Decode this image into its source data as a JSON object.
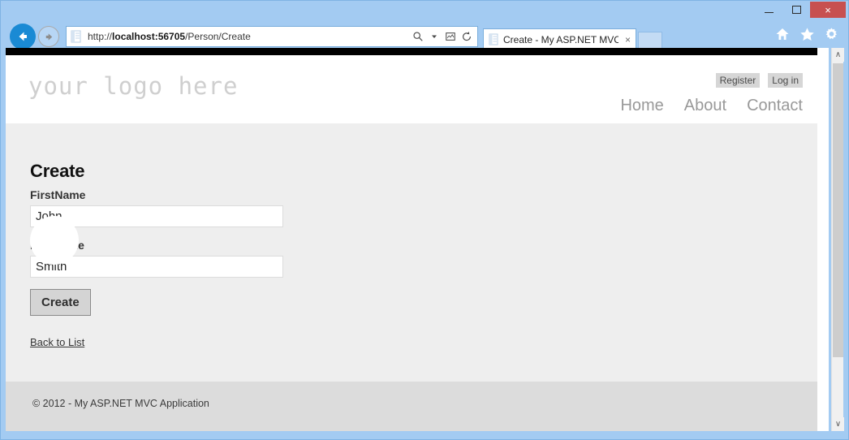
{
  "browser": {
    "window_controls": {
      "minimize": "–",
      "maximize": "□",
      "close": "×"
    },
    "back_icon": "back-arrow-icon",
    "forward_icon": "forward-arrow-icon",
    "url_prefix": "http://",
    "url_host": "localhost:56705",
    "url_path": "/Person/Create",
    "url_full": "http://localhost:56705/Person/Create",
    "address_icons": [
      "search-icon",
      "dropdown-caret-icon",
      "compatibility-view-icon",
      "refresh-icon"
    ],
    "tab": {
      "title": "Create - My ASP.NET MVC ...",
      "close_label": "×",
      "favicon": "page-icon"
    },
    "command_icons": [
      "home-icon",
      "favorites-star-icon",
      "settings-gear-icon"
    ],
    "scrollbar": {
      "up_arrow": "∧",
      "down_arrow": "∨"
    }
  },
  "site": {
    "logo_text": "your logo here",
    "auth_links": [
      {
        "label": "Register"
      },
      {
        "label": "Log in"
      }
    ],
    "nav_links": [
      {
        "label": "Home"
      },
      {
        "label": "About"
      },
      {
        "label": "Contact"
      }
    ]
  },
  "page": {
    "title": "Create",
    "fields": [
      {
        "label": "FirstName",
        "value": "John"
      },
      {
        "label": "LastName",
        "value": "Smith"
      }
    ],
    "submit_label": "Create",
    "back_link_label": "Back to List"
  },
  "footer": {
    "text": "© 2012 - My ASP.NET MVC Application"
  },
  "colors": {
    "chrome_blue": "#a3cbf2",
    "accent_blue": "#1a8ad4",
    "close_red": "#c75050",
    "body_gray": "#eeeeee",
    "footer_gray": "#dcdcdc",
    "logo_gray": "#cfcfcf"
  }
}
